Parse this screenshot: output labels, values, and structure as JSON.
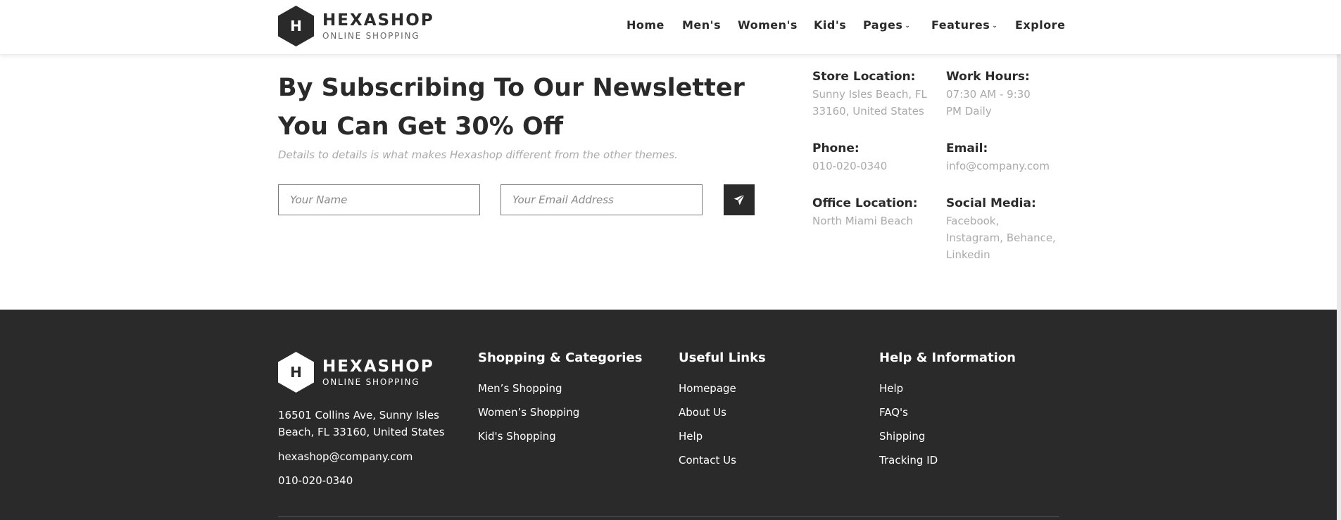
{
  "header": {
    "logo": {
      "letter": "H",
      "name": "HEXASHOP",
      "tagline": "ONLINE SHOPPING"
    },
    "nav": [
      {
        "label": "Home",
        "dropdown": false
      },
      {
        "label": "Men's",
        "dropdown": false
      },
      {
        "label": "Women's",
        "dropdown": false
      },
      {
        "label": "Kid's",
        "dropdown": false
      },
      {
        "label": "Pages",
        "dropdown": true
      },
      {
        "label": "Features",
        "dropdown": true
      },
      {
        "label": "Explore",
        "dropdown": false
      }
    ]
  },
  "newsletter": {
    "title": "By Subscribing To Our Newsletter You Can Get 30% Off",
    "description": "Details to details is what makes Hexashop different from the other themes.",
    "name_placeholder": "Your Name",
    "email_placeholder": "Your Email Address",
    "submit_icon": "paper-plane-icon"
  },
  "info": [
    {
      "label": "Store Location:",
      "value": "Sunny Isles Beach, FL 33160, United States"
    },
    {
      "label": "Work Hours:",
      "value": "07:30 AM - 9:30 PM Daily"
    },
    {
      "label": "Phone:",
      "value": "010-020-0340"
    },
    {
      "label": "Email:",
      "value": "info@company.com"
    },
    {
      "label": "Office Location:",
      "value": "North Miami Beach"
    },
    {
      "label": "Social Media:",
      "value": "Facebook, Instagram, Behance, Linkedin"
    }
  ],
  "footer": {
    "logo": {
      "letter": "H",
      "name": "HEXASHOP",
      "tagline": "ONLINE SHOPPING"
    },
    "address": "16501 Collins Ave, Sunny Isles Beach, FL 33160, United States",
    "email": "hexashop@company.com",
    "phone": "010-020-0340",
    "columns": [
      {
        "heading": "Shopping & Categories",
        "links": [
          "Men’s Shopping",
          "Women’s Shopping",
          "Kid's Shopping"
        ]
      },
      {
        "heading": "Useful Links",
        "links": [
          "Homepage",
          "About Us",
          "Help",
          "Contact Us"
        ]
      },
      {
        "heading": "Help & Information",
        "links": [
          "Help",
          "FAQ's",
          "Shipping",
          "Tracking ID"
        ]
      }
    ]
  },
  "colors": {
    "dark": "#2a2a2a",
    "muted": "#aaaaaa",
    "white": "#ffffff"
  }
}
